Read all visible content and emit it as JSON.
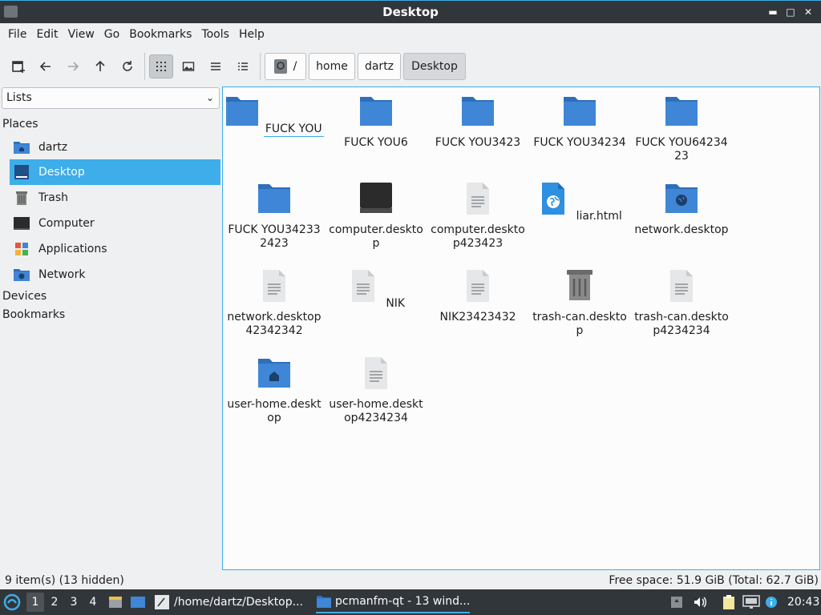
{
  "window": {
    "title": "Desktop"
  },
  "menu": [
    "File",
    "Edit",
    "View",
    "Go",
    "Bookmarks",
    "Tools",
    "Help"
  ],
  "breadcrumbs": [
    "/",
    "home",
    "dartz",
    "Desktop"
  ],
  "side": {
    "selector": "Lists",
    "places_header": "Places",
    "places": [
      "dartz",
      "Desktop",
      "Trash",
      "Computer",
      "Applications",
      "Network"
    ],
    "devices_header": "Devices",
    "bookmarks_header": "Bookmarks"
  },
  "files": [
    "FUCK YOU",
    "FUCK YOU6",
    "FUCK YOU3423",
    "FUCK YOU34234",
    "FUCK YOU6423423",
    "FUCK YOU342332423",
    "computer.desktop",
    "computer.desktop423423",
    "liar.html",
    "network.desktop",
    "network.desktop42342342",
    "NIK",
    "NIK23423432",
    "trash-can.desktop",
    "trash-can.desktop4234234",
    "user-home.desktop",
    "user-home.desktop4234234"
  ],
  "status": {
    "left": "9 item(s) (13 hidden)",
    "right": "Free space: 51.9 GiB (Total: 62.7 GiB)"
  },
  "taskbar": {
    "desktops": [
      "1",
      "2",
      "3",
      "4"
    ],
    "tasks": [
      "/home/dartz/Desktop...",
      "pcmanfm-qt - 13 wind..."
    ],
    "clock": "20:43"
  },
  "colors": {
    "accent": "#3daee9",
    "folder": "#3f86d6",
    "titlebar": "#31363b"
  }
}
